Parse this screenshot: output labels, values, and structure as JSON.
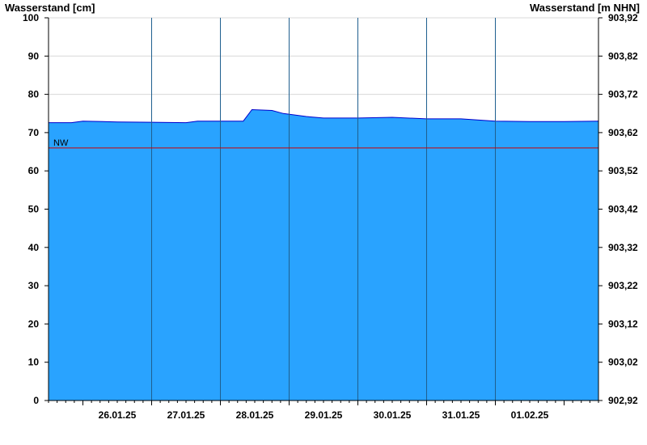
{
  "chart_data": {
    "type": "area",
    "y_left_title": "Wasserstand [cm]",
    "y_right_title": "Wasserstand [m NHN]",
    "ylim": [
      0,
      100
    ],
    "y_ticks": [
      0,
      10,
      20,
      30,
      40,
      50,
      60,
      70,
      80,
      90,
      100
    ],
    "y_right_ticks": [
      "902,92",
      "903,02",
      "903,12",
      "903,22",
      "903,32",
      "903,42",
      "903,52",
      "903,62",
      "903,72",
      "903,82",
      "903,92"
    ],
    "x_range": [
      "2025-01-25T12:00",
      "2025-02-02T12:00"
    ],
    "x_day_labels": [
      "26.01.25",
      "27.01.25",
      "28.01.25",
      "29.01.25",
      "30.01.25",
      "31.01.25",
      "01.02.25"
    ],
    "grid": "horizontal lines at y ticks, vertical lines at day boundaries",
    "series": [
      {
        "color": "#29a3ff",
        "points": [
          [
            "2025-01-25T12:00",
            72.6
          ],
          [
            "2025-01-25T20:00",
            72.6
          ],
          [
            "2025-01-26T00:00",
            73.0
          ],
          [
            "2025-01-26T12:00",
            72.8
          ],
          [
            "2025-01-27T00:00",
            72.7
          ],
          [
            "2025-01-27T12:00",
            72.6
          ],
          [
            "2025-01-27T16:00",
            73.0
          ],
          [
            "2025-01-28T00:00",
            73.0
          ],
          [
            "2025-01-28T08:00",
            73.0
          ],
          [
            "2025-01-28T10:00",
            75.0
          ],
          [
            "2025-01-28T11:00",
            76.0
          ],
          [
            "2025-01-28T18:00",
            75.8
          ],
          [
            "2025-01-28T22:00",
            75.0
          ],
          [
            "2025-01-29T06:00",
            74.2
          ],
          [
            "2025-01-29T12:00",
            73.8
          ],
          [
            "2025-01-30T00:00",
            73.8
          ],
          [
            "2025-01-30T12:00",
            74.0
          ],
          [
            "2025-01-31T00:00",
            73.6
          ],
          [
            "2025-01-31T12:00",
            73.6
          ],
          [
            "2025-02-01T00:00",
            73.0
          ],
          [
            "2025-02-01T12:00",
            72.9
          ],
          [
            "2025-02-02T00:00",
            72.9
          ],
          [
            "2025-02-02T12:00",
            73.0
          ]
        ]
      }
    ],
    "reference_lines": [
      {
        "label": "NW",
        "y": 66,
        "color": "#cc0000"
      }
    ],
    "colors": {
      "area": "#29a3ff",
      "line": "#0000cc",
      "nw": "#cc0000",
      "gridline": "#d8d8d8",
      "day_line": "#1f5f8f"
    }
  }
}
